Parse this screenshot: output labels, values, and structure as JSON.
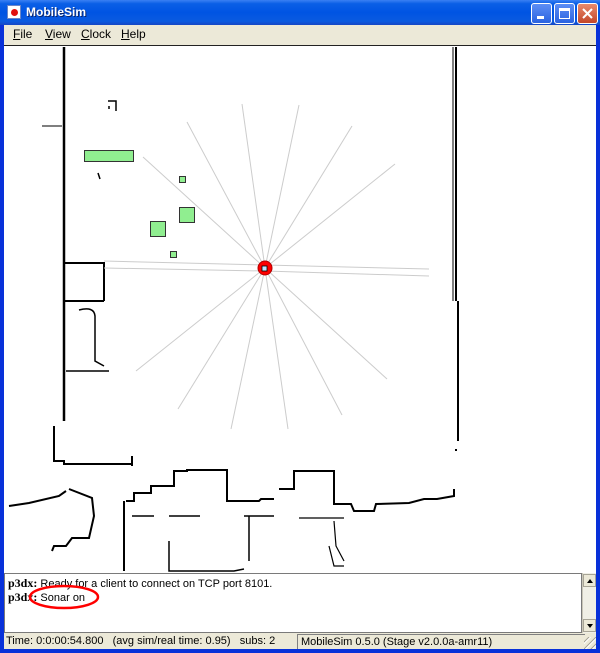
{
  "window": {
    "title": "MobileSim",
    "app_icon": "mobilesim-app-icon",
    "controls": [
      "minimize",
      "maximize",
      "close"
    ]
  },
  "menu": {
    "items": [
      {
        "label": "File",
        "accel": "F"
      },
      {
        "label": "View",
        "accel": "V"
      },
      {
        "label": "Clock",
        "accel": "C"
      },
      {
        "label": "Help",
        "accel": "H"
      }
    ]
  },
  "map": {
    "robot": {
      "name": "p3dx",
      "color": "#ff0000"
    },
    "sonar_ray_color": "#cccccc",
    "obstacle_color": "#90ee90",
    "obstacle_border": "#333333",
    "wall_color": "#000000"
  },
  "log": {
    "lines": [
      {
        "source": "p3dx:",
        "message": "Ready for a client to connect on TCP port 8101."
      },
      {
        "source": "p3dx:",
        "message": "Sonar on",
        "highlighted": true
      }
    ],
    "highlight_color": "#ff0000"
  },
  "status": {
    "time": "Time: 0:0:00:54.800",
    "avg": "(avg sim/real time: 0.95)",
    "subs": "subs: 2",
    "version": "MobileSim 0.5.0 (Stage v2.0.0a-amr11)"
  }
}
